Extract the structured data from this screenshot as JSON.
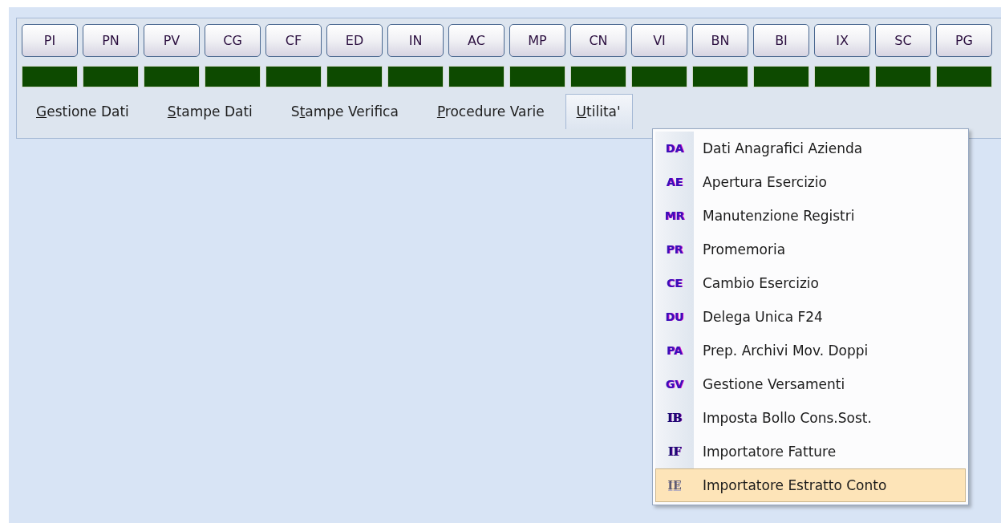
{
  "toolbar": {
    "buttons": [
      {
        "label": "PI"
      },
      {
        "label": "PN"
      },
      {
        "label": "PV"
      },
      {
        "label": "CG"
      },
      {
        "label": "CF"
      },
      {
        "label": "ED"
      },
      {
        "label": "IN"
      },
      {
        "label": "AC"
      },
      {
        "label": "MP"
      },
      {
        "label": "CN"
      },
      {
        "label": "VI"
      },
      {
        "label": "BN"
      },
      {
        "label": "BI"
      },
      {
        "label": "IX"
      },
      {
        "label": "SC"
      },
      {
        "label": "PG"
      }
    ]
  },
  "menu_bar": [
    {
      "key": "G",
      "rest": "estione Dati",
      "selected": false
    },
    {
      "key": "S",
      "rest": "tampe Dati",
      "selected": false
    },
    {
      "prefix": "S",
      "key": "t",
      "rest": "ampe Verifica",
      "selected": false
    },
    {
      "key": "P",
      "rest": "rocedure Varie",
      "selected": false
    },
    {
      "key": "U",
      "rest": "tilita'",
      "selected": true
    }
  ],
  "dropdown": {
    "items": [
      {
        "icon": "DA",
        "kind": "sans",
        "label": "Dati Anagrafici Azienda",
        "selected": false
      },
      {
        "icon": "AE",
        "kind": "sans",
        "label": "Apertura Esercizio",
        "selected": false
      },
      {
        "icon": "MR",
        "kind": "sans",
        "label": "Manutenzione Registri",
        "selected": false
      },
      {
        "icon": "PR",
        "kind": "sans",
        "label": "Promemoria",
        "selected": false
      },
      {
        "icon": "CE",
        "kind": "sans",
        "label": "Cambio Esercizio",
        "selected": false
      },
      {
        "icon": "DU",
        "kind": "sans",
        "label": "Delega Unica F24",
        "selected": false
      },
      {
        "icon": "PA",
        "kind": "sans",
        "label": "Prep. Archivi Mov. Doppi",
        "selected": false
      },
      {
        "icon": "GV",
        "kind": "sans",
        "label": "Gestione Versamenti",
        "selected": false
      },
      {
        "icon": "IB",
        "kind": "serif",
        "label": "Imposta Bollo Cons.Sost.",
        "selected": false
      },
      {
        "icon": "IF",
        "kind": "serif",
        "label": "Importatore Fatture",
        "selected": false
      },
      {
        "icon": "IE",
        "kind": "striped",
        "label": "Importatore Estratto Conto",
        "selected": true
      }
    ]
  }
}
